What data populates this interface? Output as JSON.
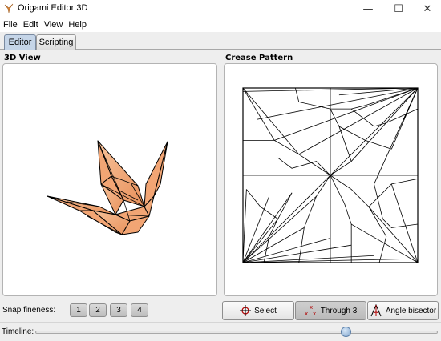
{
  "window": {
    "title": "Origami Editor 3D",
    "controls": {
      "minimize": "—",
      "maximize": "☐",
      "close": "✕"
    }
  },
  "menu": [
    "File",
    "Edit",
    "View",
    "Help"
  ],
  "tabs": [
    {
      "label": "Editor",
      "active": true
    },
    {
      "label": "Scripting",
      "active": false
    }
  ],
  "panels": {
    "view3d": {
      "label": "3D View"
    },
    "crease": {
      "label": "Crease Pattern"
    }
  },
  "model": {
    "fill_color": "#f2a574",
    "edge_color": "#000000"
  },
  "toolbar": {
    "snap_label": "Snap fineness:",
    "snap_options": [
      "1",
      "2",
      "3",
      "4"
    ],
    "tools": [
      {
        "label": "Select",
        "icon": "crosshair-icon",
        "pressed": false
      },
      {
        "label": "Through 3",
        "icon": "three-points-icon",
        "pressed": true
      },
      {
        "label": "Angle bisector",
        "icon": "angle-bisector-icon",
        "pressed": false
      }
    ]
  },
  "timeline": {
    "label": "Timeline:",
    "position_fraction": 0.77
  }
}
